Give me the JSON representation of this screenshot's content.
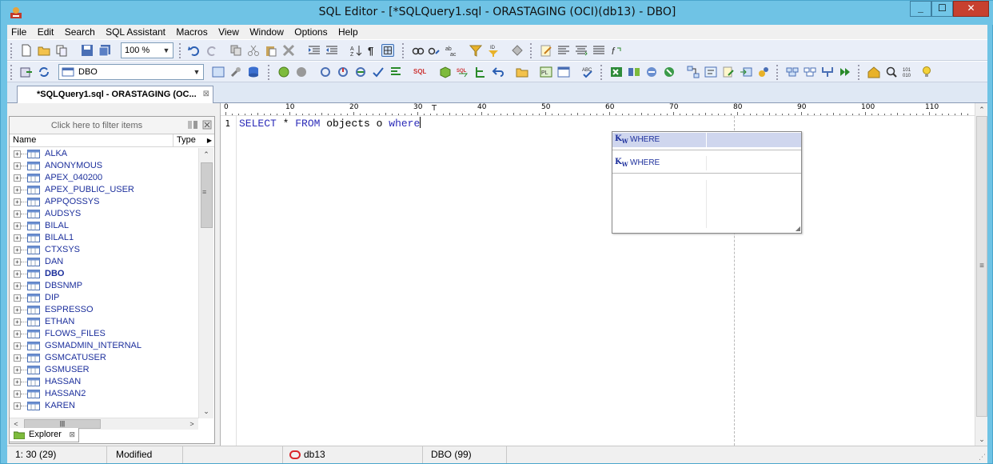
{
  "window": {
    "title": "SQL Editor - [*SQLQuery1.sql - ORASTAGING (OCI)(db13) - DBO]",
    "buttons": {
      "minimize": "_",
      "maximize": "☐",
      "close": "✕"
    }
  },
  "menu": [
    "File",
    "Edit",
    "Search",
    "SQL Assistant",
    "Macros",
    "View",
    "Window",
    "Options",
    "Help"
  ],
  "toolbar": {
    "zoom": "100 %",
    "schema": "DBO"
  },
  "doc_tab": {
    "label": "*SQLQuery1.sql - ORASTAGING (OC...",
    "close": "⊠"
  },
  "explorer": {
    "filter_placeholder": "Click here to filter items",
    "col_name": "Name",
    "col_type": "Type",
    "tab_label": "Explorer",
    "tab_close": "⊠",
    "items": [
      {
        "label": "ALKA"
      },
      {
        "label": "ANONYMOUS"
      },
      {
        "label": "APEX_040200"
      },
      {
        "label": "APEX_PUBLIC_USER"
      },
      {
        "label": "APPQOSSYS"
      },
      {
        "label": "AUDSYS"
      },
      {
        "label": "BILAL"
      },
      {
        "label": "BILAL1"
      },
      {
        "label": "CTXSYS"
      },
      {
        "label": "DAN"
      },
      {
        "label": "DBO"
      },
      {
        "label": "DBSNMP"
      },
      {
        "label": "DIP"
      },
      {
        "label": "ESPRESSO"
      },
      {
        "label": "ETHAN"
      },
      {
        "label": "FLOWS_FILES"
      },
      {
        "label": "GSMADMIN_INTERNAL"
      },
      {
        "label": "GSMCATUSER"
      },
      {
        "label": "GSMUSER"
      },
      {
        "label": "HASSAN"
      },
      {
        "label": "HASSAN2"
      },
      {
        "label": "KAREN"
      }
    ],
    "active_item": "DBO"
  },
  "editor": {
    "line_number": "1",
    "ruler_labels": [
      "0",
      "10",
      "20",
      "30",
      "40",
      "50",
      "60",
      "70",
      "80",
      "90",
      "100",
      "110"
    ],
    "code": {
      "kw1": "SELECT",
      "star": " * ",
      "kw2": "FROM",
      "mid": " objects o ",
      "kw3": "where"
    }
  },
  "autocomplete": {
    "items": [
      {
        "icon": "KW",
        "label": "WHERE",
        "selected": true
      },
      {
        "icon": "KW",
        "label": "WHERE",
        "selected": false
      }
    ]
  },
  "status": {
    "position": "1: 30 (29)",
    "state": "Modified",
    "connection": "db13",
    "schema": "DBO (99)"
  },
  "colors": {
    "title_bar": "#6fc3e5",
    "close_button": "#c7402f",
    "keyword": "#2b2bb8",
    "tree_text": "#1c2f9c",
    "selection": "#cfd6ee"
  }
}
